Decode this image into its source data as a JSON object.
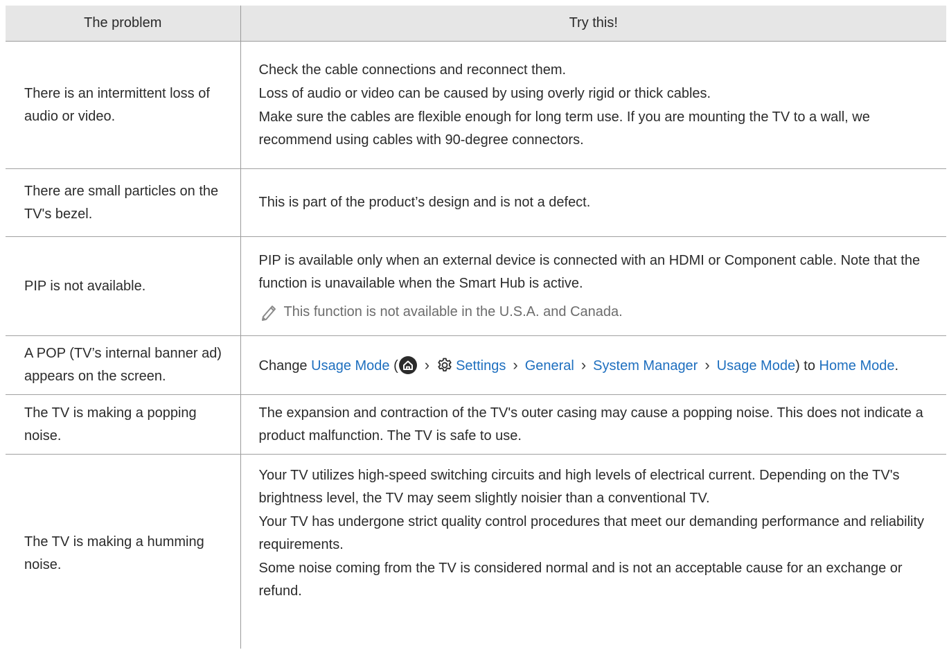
{
  "table": {
    "headers": {
      "problem": "The problem",
      "solution": "Try this!"
    },
    "rows": [
      {
        "problem": "There is an intermittent loss of audio or video.",
        "solutions": [
          "Check the cable connections and reconnect them.",
          "Loss of audio or video can be caused by using overly rigid or thick cables.",
          "Make sure the cables are flexible enough for long term use. If you are mounting the TV to a wall, we recommend using cables with 90-degree connectors."
        ]
      },
      {
        "problem": "There are small particles on the TV's bezel.",
        "solutions": [
          "This is part of the product’s design and is not a defect."
        ]
      },
      {
        "problem": "PIP is not available.",
        "solutions": [
          "PIP is available only when an external device is connected with an HDMI or Component cable. Note that the function is unavailable when the Smart Hub is active."
        ],
        "note": "This function is not available in the U.S.A. and Canada.",
        "note_icon": "pencil-icon"
      },
      {
        "problem": "A POP (TV’s internal banner ad) appears on the screen.",
        "path": {
          "prefix": "Change",
          "target": "Usage Mode",
          "open_paren": "(",
          "home_icon": "home-icon",
          "settings_icon": "gear-icon",
          "steps": [
            "Settings",
            "General",
            "System Manager",
            "Usage Mode"
          ],
          "close_paren": ") to",
          "result": "Home Mode",
          "end": "."
        }
      },
      {
        "problem": "The TV is making a popping noise.",
        "solutions": [
          "The expansion and contraction of the TV's outer casing may cause a popping noise. This does not indicate a product malfunction. The TV is safe to use."
        ]
      },
      {
        "problem": "The TV is making a humming noise.",
        "solutions": [
          "Your TV utilizes high-speed switching circuits and high levels of electrical current. Depending on the TV's brightness level, the TV may seem slightly noisier than a conventional TV.",
          "Your TV has undergone strict quality control procedures that meet our demanding performance and reliability requirements.",
          "Some noise coming from the TV is considered normal and is not an acceptable cause for an exchange or refund."
        ]
      }
    ]
  },
  "colors": {
    "header_bg": "#e6e6e6",
    "link": "#1e6fbf",
    "note_text": "#6c6c6c",
    "border": "#9a9a9a"
  }
}
